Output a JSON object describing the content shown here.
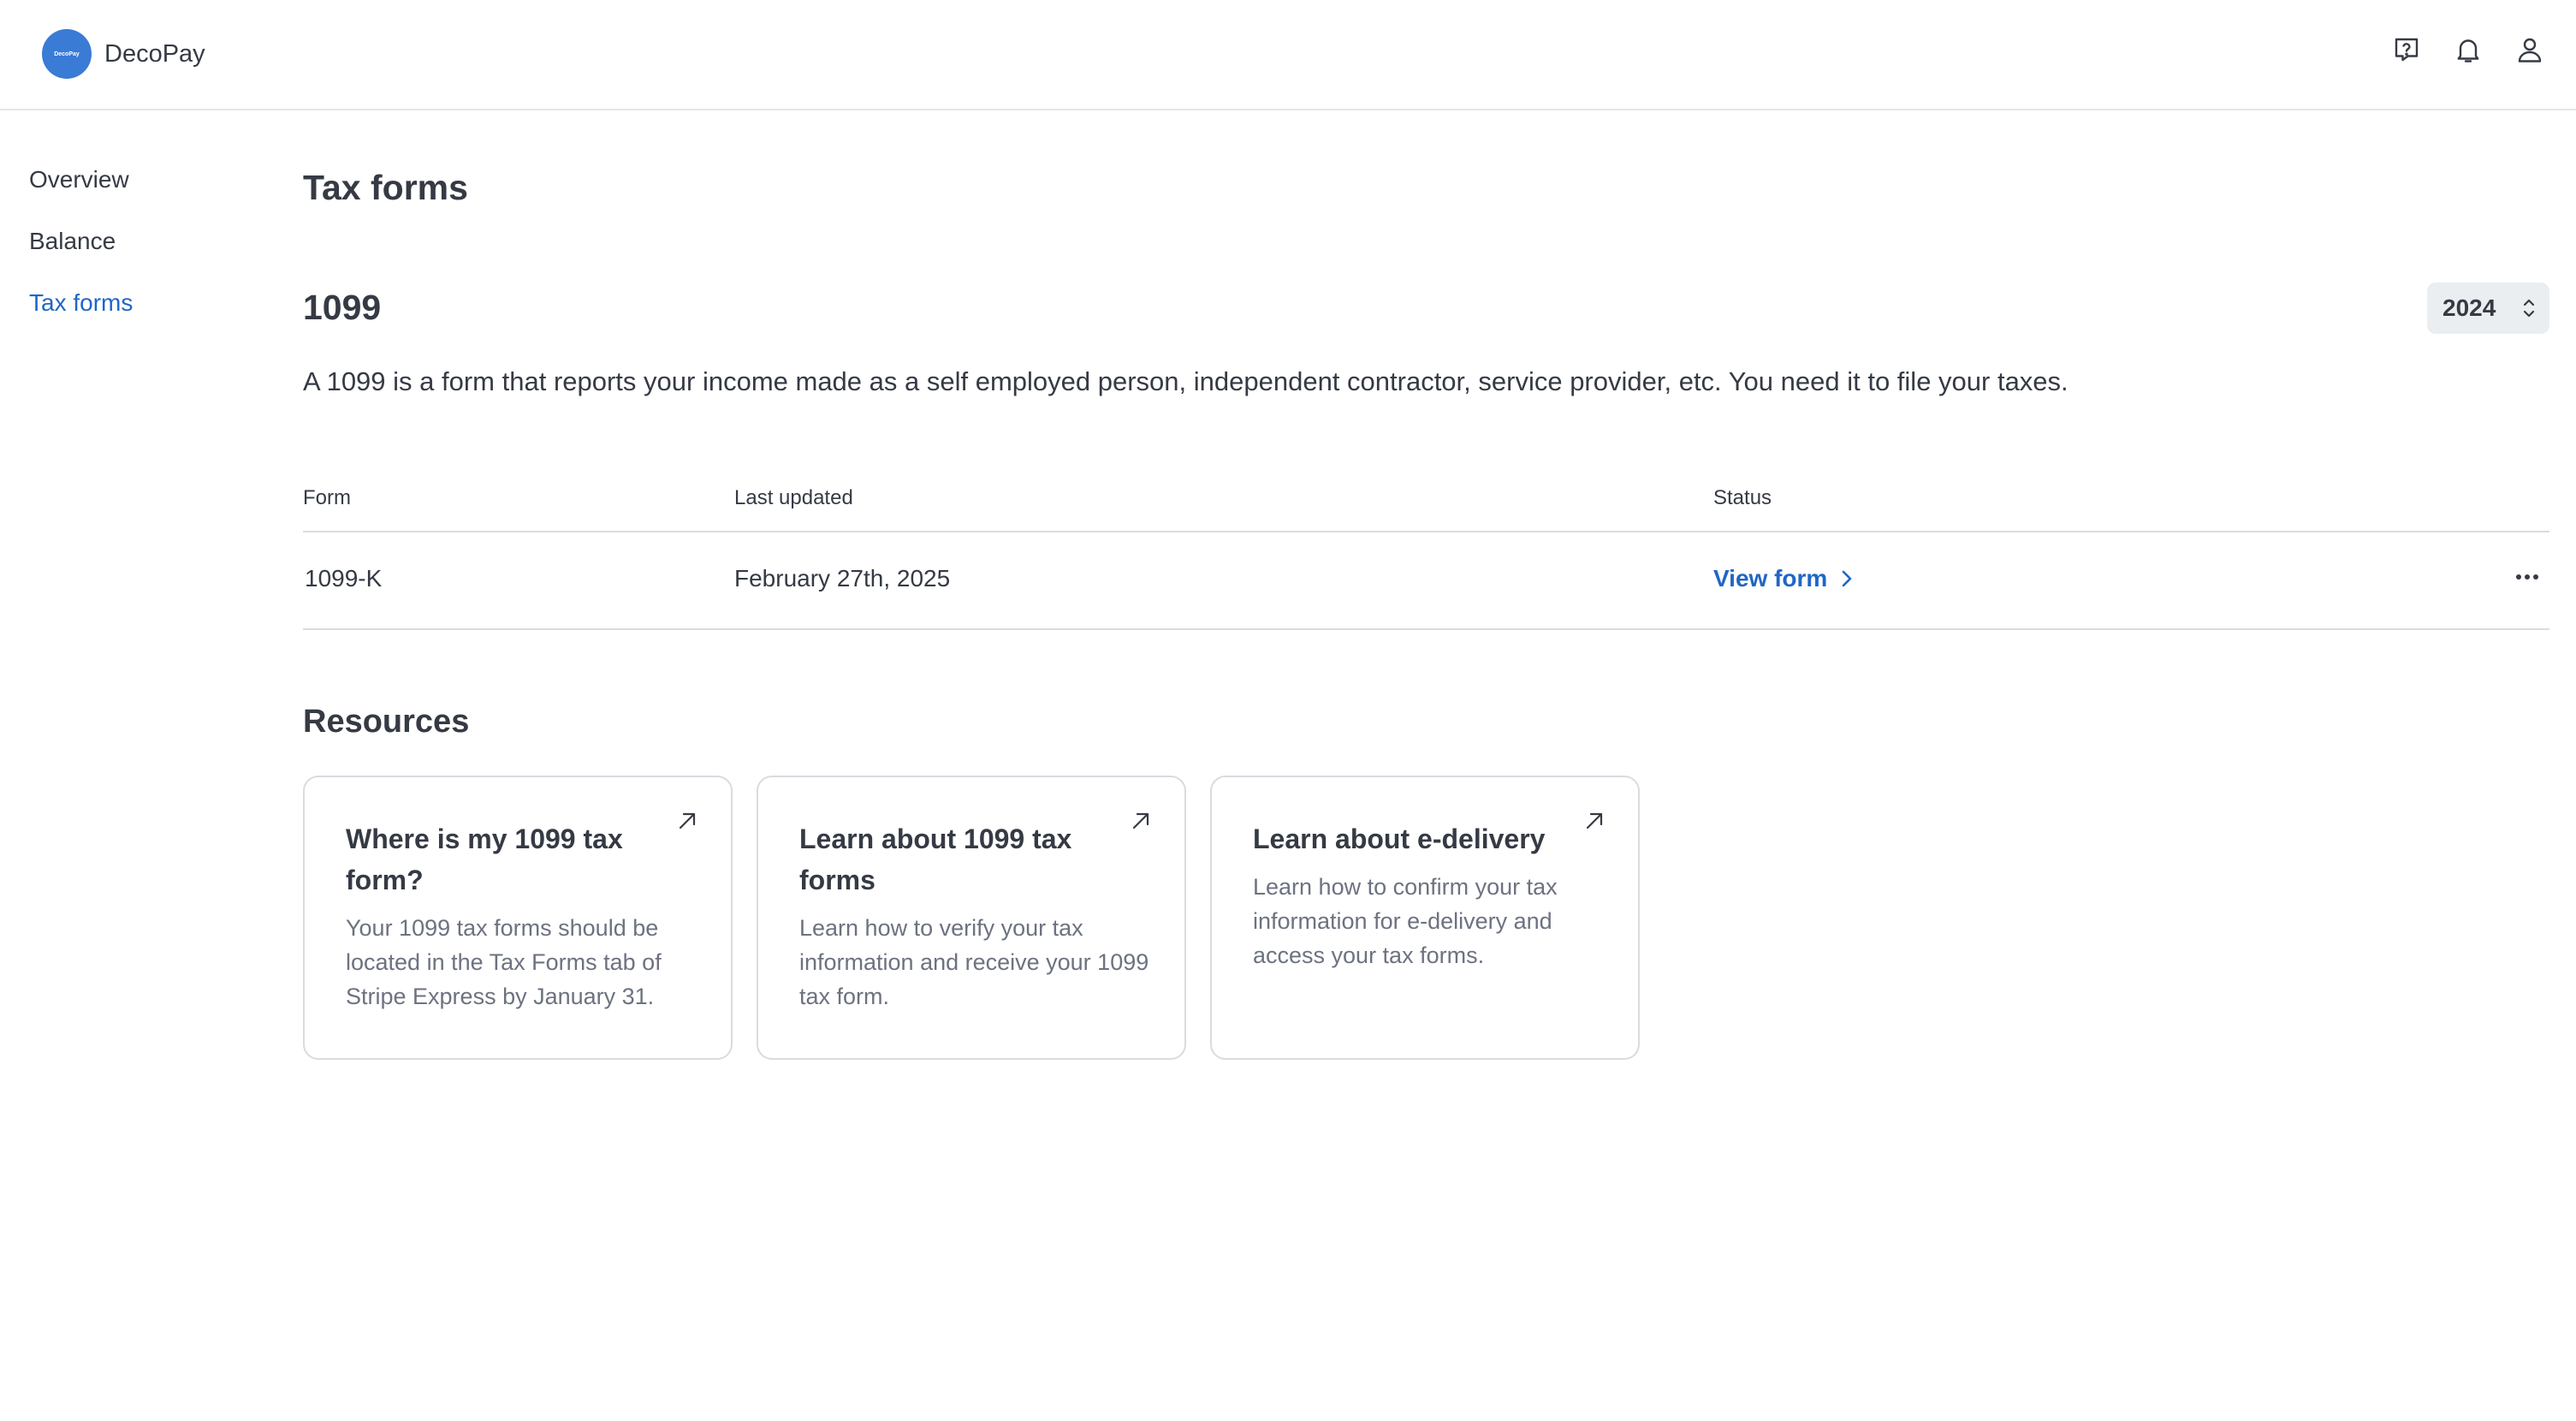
{
  "app": {
    "name": "DecoPay",
    "logo_text": "DecoPay"
  },
  "header": {
    "icons": [
      "help-icon",
      "bell-icon",
      "user-icon"
    ]
  },
  "sidebar": {
    "items": [
      {
        "label": "Overview",
        "active": false
      },
      {
        "label": "Balance",
        "active": false
      },
      {
        "label": "Tax forms",
        "active": true
      }
    ]
  },
  "main": {
    "page_title": "Tax forms",
    "section_title": "1099",
    "year_select": {
      "value": "2024"
    },
    "description": "A 1099 is a form that reports your income made as a self employed person, independent contractor, service provider, etc. You need it to file your taxes.",
    "table": {
      "headers": {
        "form": "Form",
        "last_updated": "Last updated",
        "status": "Status"
      },
      "rows": [
        {
          "form": "1099-K",
          "last_updated": "February 27th, 2025",
          "status_link": "View form"
        }
      ]
    },
    "resources": {
      "title": "Resources",
      "cards": [
        {
          "title": "Where is my 1099 tax form?",
          "body": "Your 1099 tax forms should be located in the Tax Forms tab of Stripe Express by January 31."
        },
        {
          "title": "Learn about 1099 tax forms",
          "body": "Learn how to verify your tax information and receive your 1099 tax form."
        },
        {
          "title": "Learn about e-delivery",
          "body": "Learn how to confirm your tax information for e-delivery and access your tax forms."
        }
      ]
    }
  },
  "colors": {
    "accent": "#2066c7",
    "text": "#353a44",
    "muted": "#6c7280",
    "border": "#d8dbe0"
  }
}
